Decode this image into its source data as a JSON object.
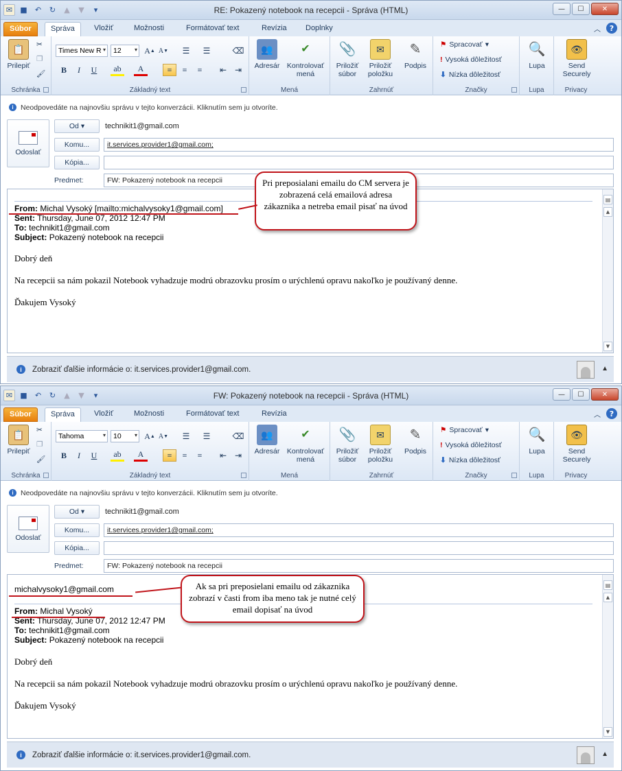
{
  "windows": [
    {
      "title": "RE: Pokazený notebook na recepcii - Správa (HTML)",
      "tabs": [
        "Súbor",
        "Správa",
        "Vložiť",
        "Možnosti",
        "Formátovať text",
        "Revízia",
        "Doplnky"
      ],
      "font_name": "Times New R",
      "font_size": "12",
      "info_bar": "Neodpovedáte na najnovšiu správu v tejto konverzácii. Kliknutím sem ju otvoríte.",
      "from_button": "Od",
      "from_value": "technikit1@gmail.com",
      "to_button": "Komu...",
      "to_value": "it.services.provider1@gmail.com;",
      "cc_button": "Kópia...",
      "cc_value": "",
      "subject_label": "Predmet:",
      "subject_value": "FW: Pokazený notebook na recepcii",
      "extra_line": "",
      "from_label": "From:",
      "from_text": "Michal Vysoký [mailto:michalvysoky1@gmail.com]",
      "sent_label": "Sent:",
      "sent_text": "Thursday, June 07, 2012 12:47 PM",
      "to_label": "To:",
      "to_text": "technikit1@gmail.com",
      "subj_label": "Subject:",
      "subj_text": "Pokazený notebook na recepcii",
      "greeting": "Dobrý deň",
      "body": "Na recepcii sa nám pokazil Notebook vyhadzuje modrú obrazovku prosím o urýchlenú opravu nakoľko je používaný denne.",
      "closing": "Ďakujem  Vysoký",
      "people_pane": "Zobraziť ďalšie informácie o: it.services.provider1@gmail.com.",
      "callout": "Pri preposialani emailu do CM servera je zobrazená celá emailová adresa zákaznika a netreba email pisať na úvod"
    },
    {
      "title": "FW: Pokazený notebook na recepcii - Správa (HTML)",
      "tabs": [
        "Súbor",
        "Správa",
        "Vložiť",
        "Možnosti",
        "Formátovať text",
        "Revízia"
      ],
      "font_name": "Tahoma",
      "font_size": "10",
      "info_bar": "Neodpovedáte na najnovšiu správu v tejto konverzácii. Kliknutím sem ju otvoríte.",
      "from_button": "Od",
      "from_value": "technikit1@gmail.com",
      "to_button": "Komu...",
      "to_value": "it.services.provider1@gmail.com;",
      "cc_button": "Kópia...",
      "cc_value": "",
      "subject_label": "Predmet:",
      "subject_value": "FW: Pokazený notebook na recepcii",
      "extra_line": "michalvysoky1@gmail.com",
      "from_label": "From:",
      "from_text": "Michal Vysoký",
      "sent_label": "Sent:",
      "sent_text": "Thursday, June 07, 2012 12:47 PM",
      "to_label": "To:",
      "to_text": "technikit1@gmail.com",
      "subj_label": "Subject:",
      "subj_text": "Pokazený notebook na recepcii",
      "greeting": "Dobrý deň",
      "body": "Na recepcii sa nám pokazil Notebook vyhadzuje modrú obrazovku prosím o urýchlenú opravu nakoľko je používaný denne.",
      "closing": "Ďakujem  Vysoký",
      "people_pane": "Zobraziť ďalšie informácie o: it.services.provider1@gmail.com.",
      "callout": "Ak sa pri preposielani emailu od zákaznika zobrazí v časti from iba meno tak je nutné celý email  dopisať na úvod"
    }
  ],
  "ribbon": {
    "paste": "Prilepiť",
    "clipboard": "Schránka",
    "basic_text": "Základný text",
    "address_book": "Adresár",
    "check_names": "Kontrolovať mená",
    "names": "Mená",
    "attach_file": "Priložiť súbor",
    "attach_item": "Priložiť položku",
    "signature": "Podpis",
    "include": "Zahrnúť",
    "follow_up": "Spracovať",
    "high_importance": "Vysoká dôležitosť",
    "low_importance": "Nízka dôležitosť",
    "tags": "Značky",
    "zoom": "Lupa",
    "zoom_group": "Lupa",
    "send_securely": "Send Securely",
    "privacy": "Privacy",
    "send": "Odoslať"
  },
  "colors": {
    "accent": "#e77f0e",
    "callout_border": "#c0141a",
    "ribbon": "#dce7f5"
  }
}
